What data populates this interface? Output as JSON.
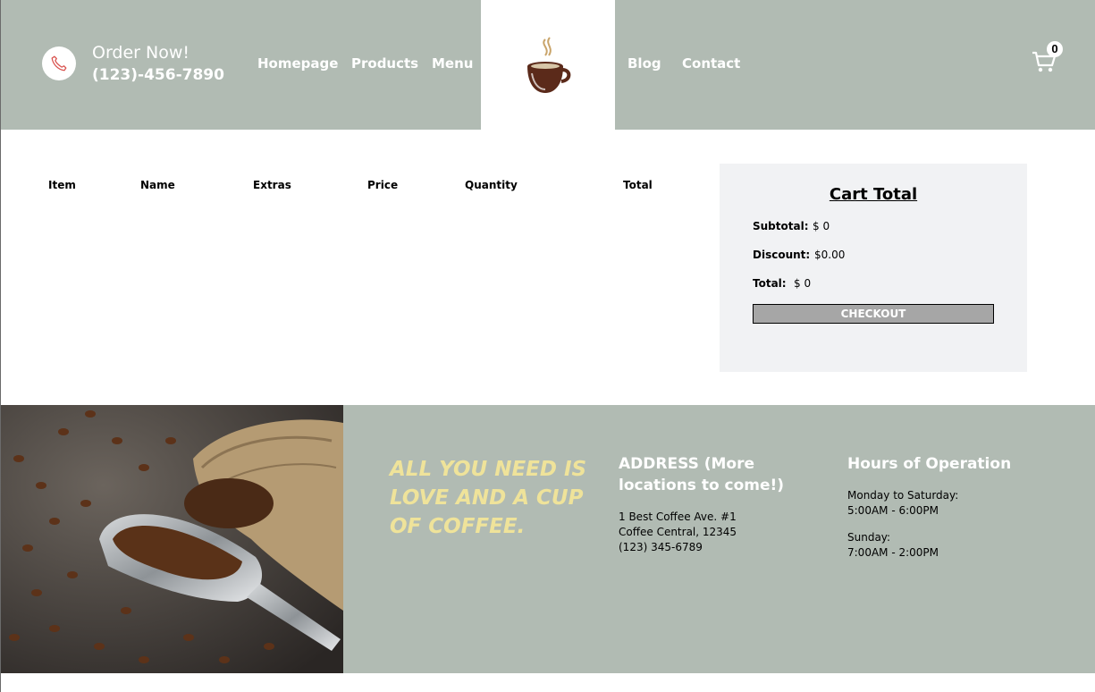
{
  "header": {
    "order_title": "Order Now!",
    "order_phone": "(123)-456-7890",
    "nav": [
      "Homepage",
      "Products",
      "Menu",
      "Blog",
      "Contact"
    ],
    "cart_count": "0"
  },
  "cart_table": {
    "headers": [
      "Item",
      "Name",
      "Extras",
      "Price",
      "Quantity",
      "Total"
    ]
  },
  "cart_total": {
    "title": "Cart Total",
    "subtotal_label": "Subtotal:",
    "subtotal_value": "$ 0",
    "discount_label": "Discount:",
    "discount_value": "$0.00",
    "total_label": "Total:",
    "total_value": "$ 0",
    "checkout_label": "CHECKOUT"
  },
  "footer": {
    "slogan": "ALL YOU NEED IS LOVE AND A CUP OF COFFEE.",
    "address_title": "ADDRESS (More locations to come!)",
    "address_lines": [
      "1 Best Coffee Ave. #1",
      "Coffee Central, 12345",
      "(123) 345-6789"
    ],
    "hours_title": "Hours of Operation",
    "weekday_label": "Monday to Saturday:",
    "weekday_hours": "5:00AM - 6:00PM",
    "sunday_label": "Sunday:",
    "sunday_hours": "7:00AM - 2:00PM"
  },
  "colors": {
    "header_bg": "#b1bbb3",
    "slogan": "#efe39a",
    "panel_bg": "#f1f2f4",
    "checkout_bg": "#a6a6a6"
  },
  "icons": [
    "phone-icon",
    "coffee-cup-logo-icon",
    "shopping-cart-icon"
  ]
}
